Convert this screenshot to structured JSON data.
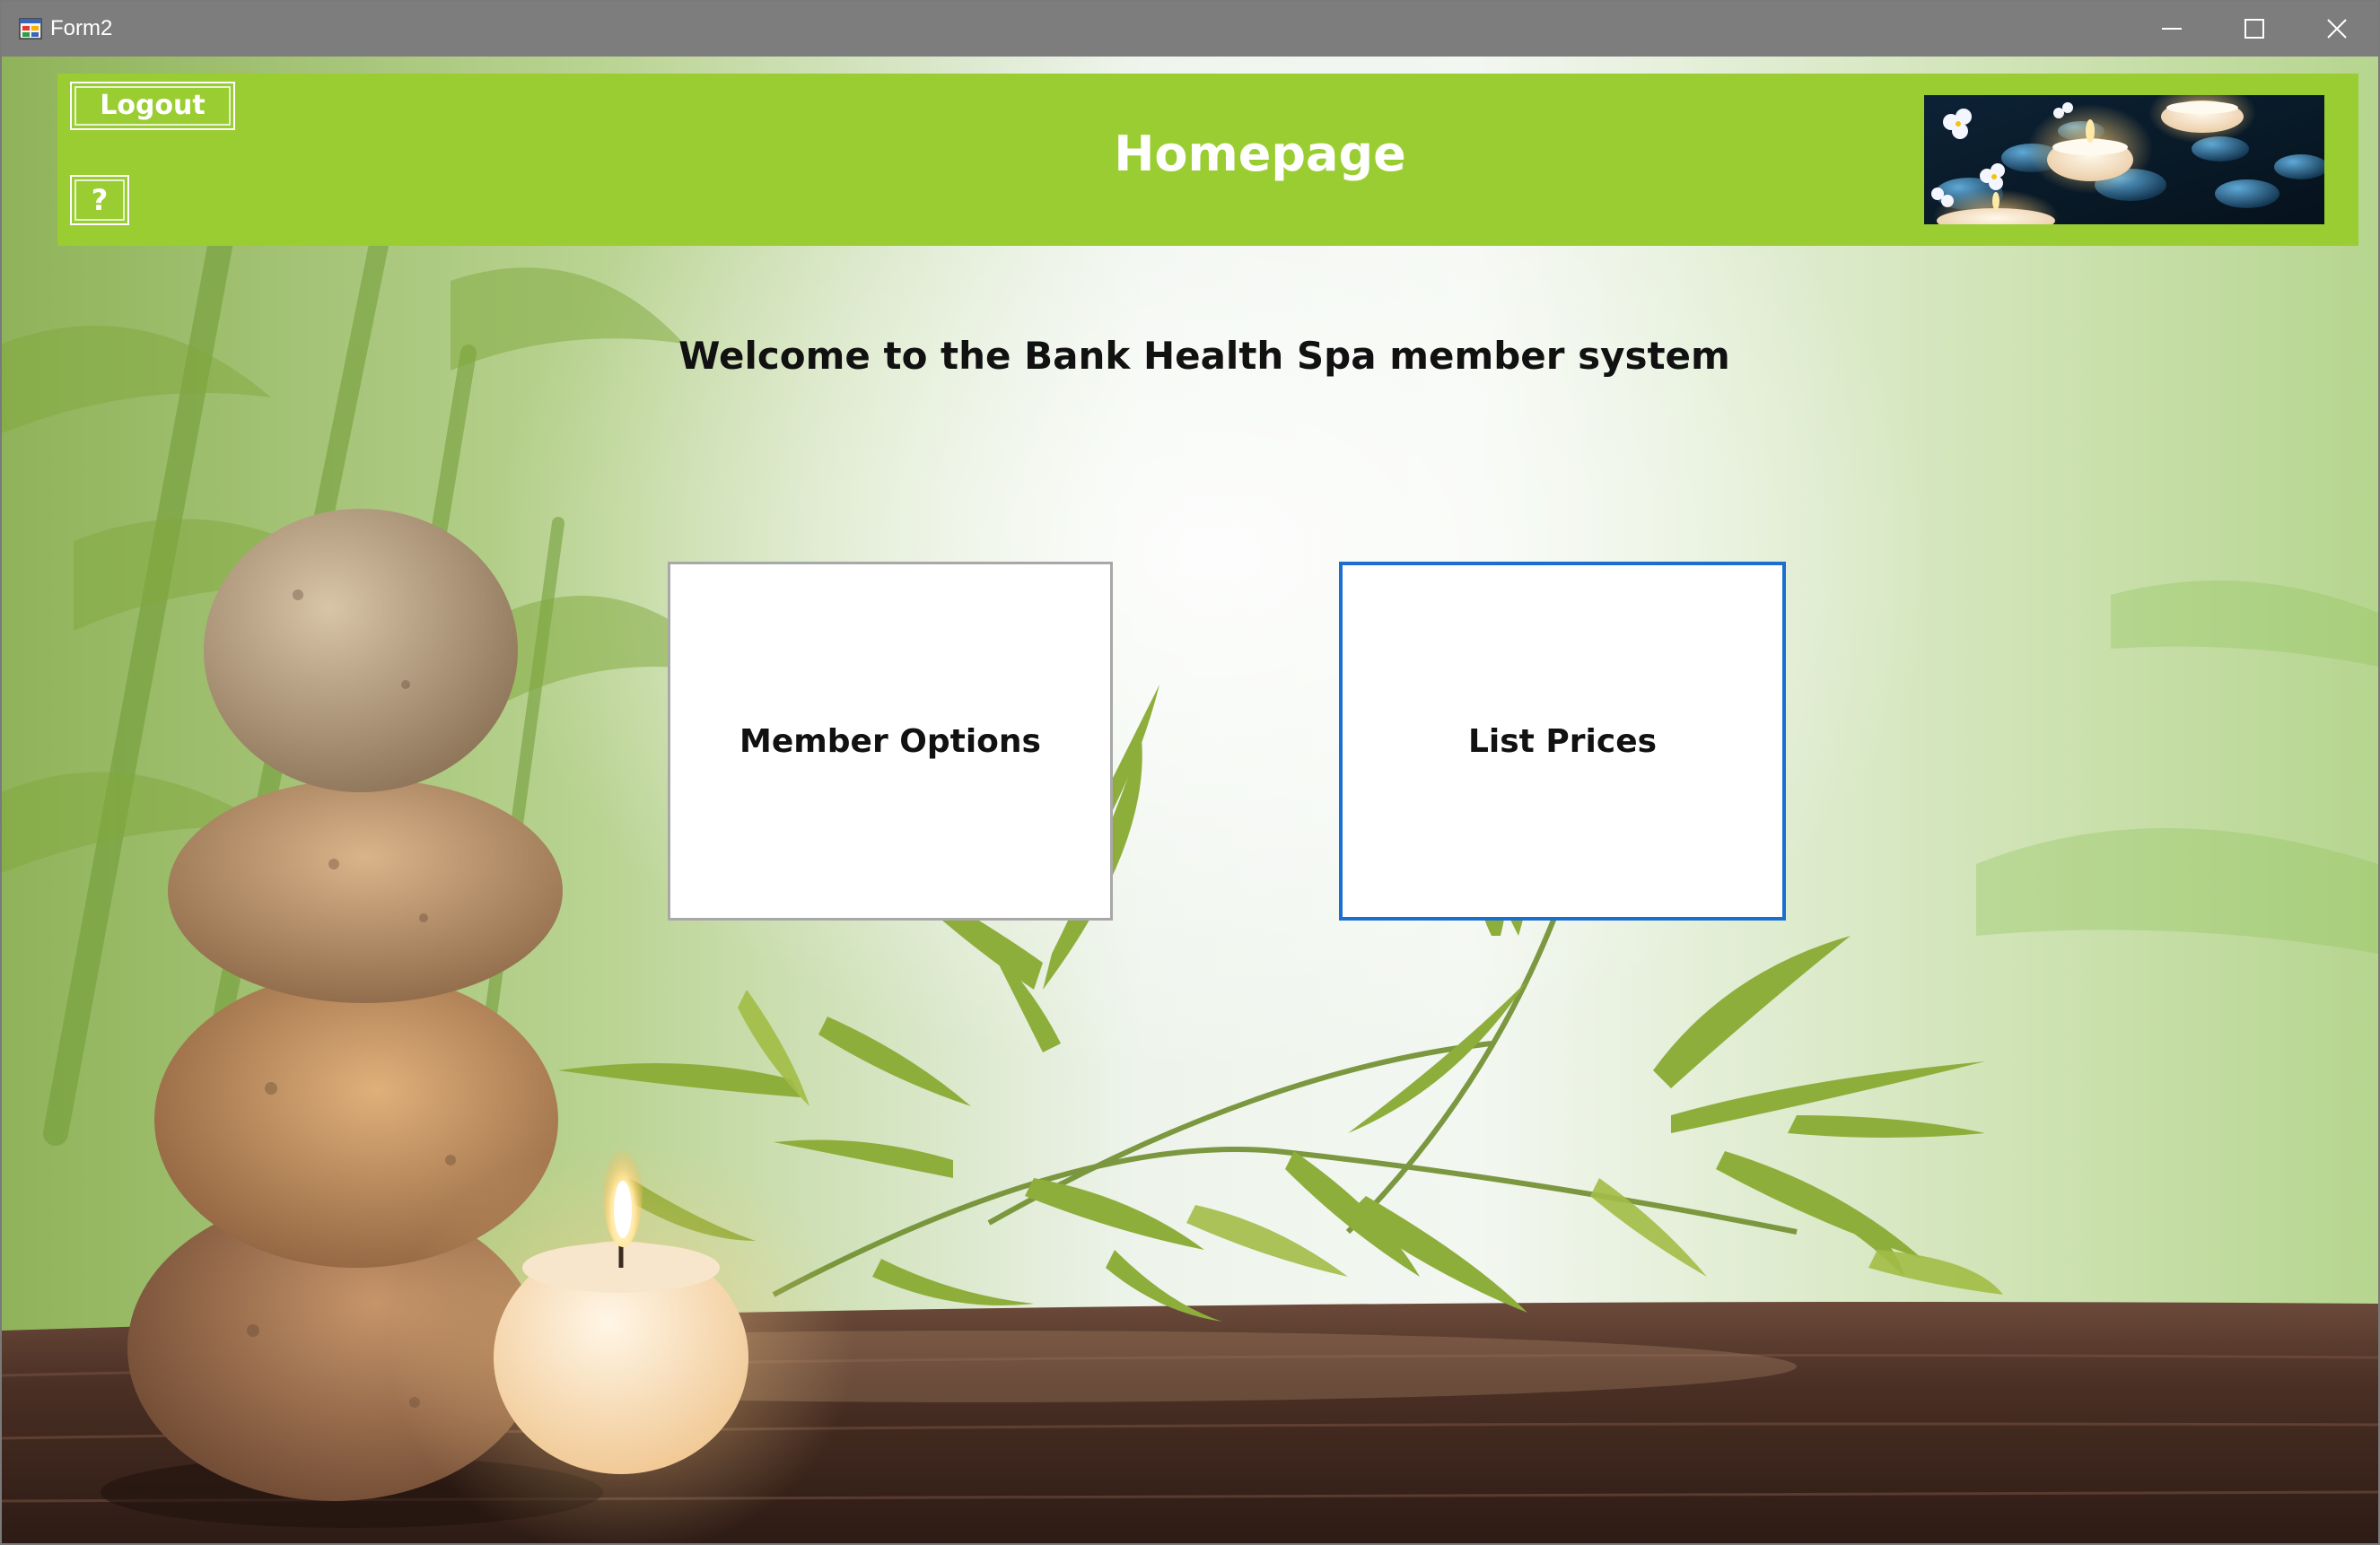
{
  "window": {
    "title": "Form2",
    "icon": "app-form-icon",
    "controls": [
      "minimize-icon",
      "maximize-icon",
      "close-icon"
    ]
  },
  "banner": {
    "logout_label": "Logout",
    "help_label": "?",
    "title": "Homepage",
    "image": "candles-and-stones-photo",
    "color": "#9acd32"
  },
  "welcome": "Welcome to the Bank Health Spa member system",
  "buttons": {
    "member_options": "Member Options",
    "list_prices": "List Prices",
    "focus_color": "#1a6fd0"
  },
  "background": "stacked-stones-bamboo-candle-photo"
}
